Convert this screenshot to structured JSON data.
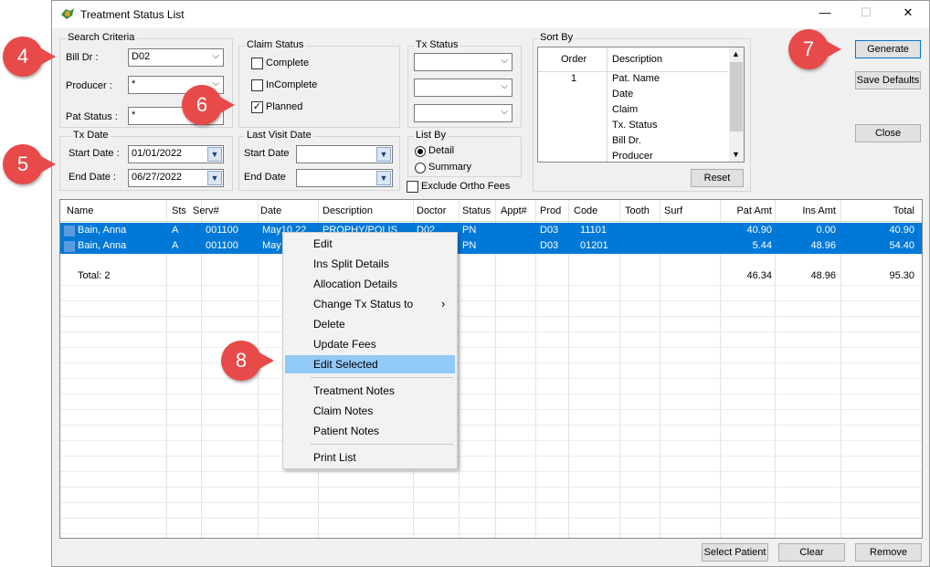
{
  "window": {
    "title": "Treatment Status List",
    "minimize": "—",
    "maximize": "☐",
    "close": "✕"
  },
  "search": {
    "legend": "Search Criteria",
    "bill_dr_label": "Bill Dr :",
    "bill_dr_value": "D02",
    "producer_label": "Producer :",
    "producer_value": "*",
    "pat_status_label": "Pat Status :",
    "pat_status_value": "*"
  },
  "claim_status": {
    "legend": "Claim Status",
    "complete": "Complete",
    "incomplete": "InComplete",
    "planned": "Planned",
    "planned_checked": true
  },
  "tx_status": {
    "legend": "Tx Status"
  },
  "tx_date": {
    "legend": "Tx Date",
    "start_label": "Start Date :",
    "start_value": "01/01/2022",
    "end_label": "End Date :",
    "end_value": "06/27/2022"
  },
  "last_visit": {
    "legend": "Last Visit Date",
    "start_label": "Start Date",
    "end_label": "End Date"
  },
  "list_by": {
    "legend": "List By",
    "detail": "Detail",
    "summary": "Summary",
    "exclude_ortho": "Exclude Ortho Fees"
  },
  "sort_by": {
    "legend": "Sort By",
    "col_order": "Order",
    "col_desc": "Description",
    "reset": "Reset",
    "rows": [
      {
        "order": "1",
        "desc": "Pat. Name"
      },
      {
        "order": "",
        "desc": "Date"
      },
      {
        "order": "",
        "desc": "Claim"
      },
      {
        "order": "",
        "desc": "Tx. Status"
      },
      {
        "order": "",
        "desc": "Bill Dr."
      },
      {
        "order": "",
        "desc": "Producer"
      }
    ]
  },
  "buttons": {
    "generate": "Generate",
    "save_defaults": "Save Defaults",
    "close": "Close",
    "select_patient": "Select Patient",
    "clear": "Clear",
    "remove": "Remove"
  },
  "grid": {
    "headers": [
      "Name",
      "Sts",
      "Serv#",
      "Date",
      "Description",
      "Doctor",
      "Status",
      "Appt#",
      "Prod",
      "Code",
      "Tooth",
      "Surf",
      "Pat Amt",
      "Ins Amt",
      "Total"
    ],
    "rows": [
      [
        "Bain, Anna",
        "A",
        "001100",
        "May10,22",
        "PROPHY/POLIS",
        "D02",
        "PN",
        "",
        "D03",
        "11101",
        "",
        "",
        "40.90",
        "0.00",
        "40.90"
      ],
      [
        "Bain, Anna",
        "A",
        "001100",
        "May",
        "",
        "",
        "PN",
        "",
        "D03",
        "01201",
        "",
        "",
        "5.44",
        "48.96",
        "54.40"
      ]
    ],
    "total_label": "Total: 2",
    "total_pat": "46.34",
    "total_ins": "48.96",
    "total_total": "95.30"
  },
  "context_menu": {
    "items": [
      "Edit",
      "Ins Split Details",
      "Allocation Details",
      "Change Tx Status to",
      "Delete",
      "Update Fees",
      "Edit Selected",
      "Treatment Notes",
      "Claim Notes",
      "Patient Notes",
      "Print List"
    ],
    "submenu_arrow": "›"
  },
  "callouts": [
    "4",
    "5",
    "6",
    "7",
    "8"
  ],
  "colors": {
    "selection": "#0078d7",
    "menu_highlight": "#91c9f7",
    "callout": "#e84a4a"
  }
}
